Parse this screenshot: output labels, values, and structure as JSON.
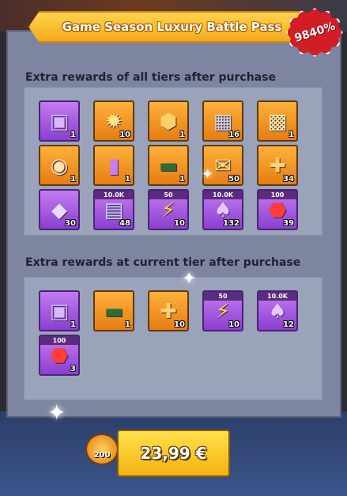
{
  "header": {
    "title": "Game Season Luxury Battle Pass",
    "badge": "9840%"
  },
  "all_tiers": {
    "title": "Extra rewards of all tiers after purchase",
    "items": [
      {
        "icon": "purple-chest-icon",
        "count": "1",
        "top": ""
      },
      {
        "icon": "gold-emblem-icon",
        "count": "10",
        "top": ""
      },
      {
        "icon": "sg-badge-icon",
        "count": "1",
        "top": ""
      },
      {
        "icon": "crate-icon",
        "count": "16",
        "top": ""
      },
      {
        "icon": "gold-chest-icon",
        "count": "1",
        "top": ""
      },
      {
        "icon": "avatar-swap-icon",
        "count": "1",
        "top": ""
      },
      {
        "icon": "purple-book-icon",
        "count": "1",
        "top": ""
      },
      {
        "icon": "name-plate-icon",
        "count": "1",
        "top": ""
      },
      {
        "icon": "gold-ticket-icon",
        "count": "50",
        "top": ""
      },
      {
        "icon": "puzzle-piece-icon",
        "count": "34",
        "top": ""
      },
      {
        "icon": "exp-card-icon",
        "count": "30",
        "top": ""
      },
      {
        "icon": "exp-book-icon",
        "count": "48",
        "top": "10.0K"
      },
      {
        "icon": "lightning-icon",
        "count": "10",
        "top": "50"
      },
      {
        "icon": "mushroom-icon",
        "count": "132",
        "top": "10.0K"
      },
      {
        "icon": "red-gem-icon",
        "count": "39",
        "top": "100"
      }
    ]
  },
  "current_tier": {
    "title": "Extra rewards at current tier after purchase",
    "items": [
      {
        "icon": "purple-chest-icon",
        "count": "1",
        "top": ""
      },
      {
        "icon": "name-plate-icon",
        "count": "1",
        "top": ""
      },
      {
        "icon": "puzzle-piece-icon",
        "count": "10",
        "top": ""
      },
      {
        "icon": "lightning-icon",
        "count": "10",
        "top": "50"
      },
      {
        "icon": "mushroom-icon",
        "count": "12",
        "top": "10.0K"
      },
      {
        "icon": "red-gem-icon",
        "count": "3",
        "top": "100"
      }
    ]
  },
  "purchase": {
    "price": "23,99 €",
    "points": "200"
  }
}
